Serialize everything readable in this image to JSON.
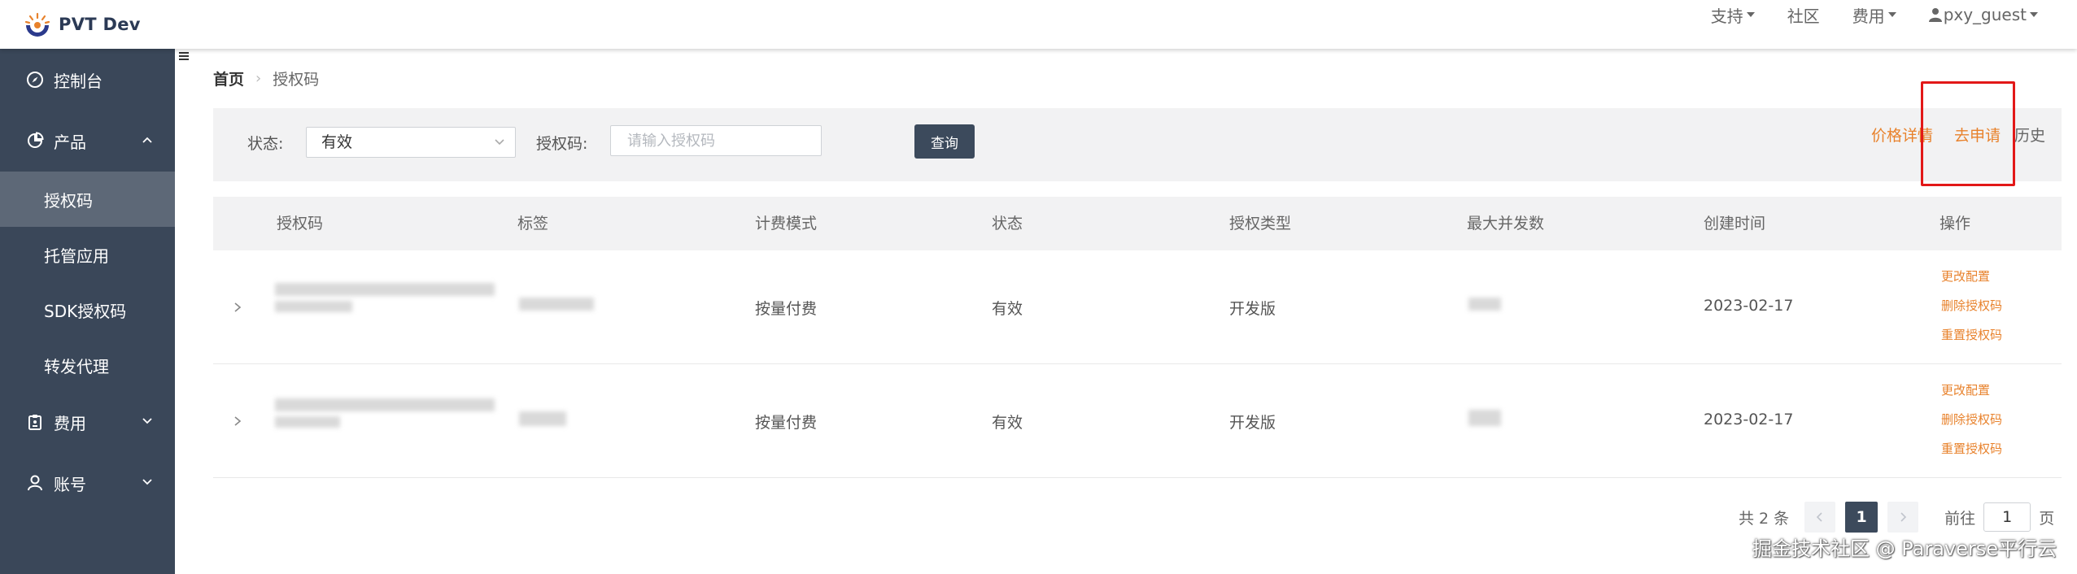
{
  "app": {
    "brand": "PVT Dev"
  },
  "topnav": {
    "support": "支持",
    "community": "社区",
    "fees": "费用",
    "user": "pxy_guest"
  },
  "sidebar": {
    "items": [
      {
        "label": "控制台"
      },
      {
        "label": "产品"
      },
      {
        "label": "授权码"
      },
      {
        "label": "托管应用"
      },
      {
        "label": "SDK授权码"
      },
      {
        "label": "转发代理"
      },
      {
        "label": "费用"
      },
      {
        "label": "账号"
      }
    ]
  },
  "breadcrumb": {
    "home": "首页",
    "current": "授权码"
  },
  "filters": {
    "status_label": "状态:",
    "status_value": "有效",
    "code_label": "授权码:",
    "code_placeholder": "请输入授权码",
    "query_button": "查询"
  },
  "links": {
    "price": "价格详情",
    "apply": "去申请",
    "history": "历史"
  },
  "table": {
    "headers": [
      "授权码",
      "标签",
      "计费模式",
      "状态",
      "授权类型",
      "最大并发数",
      "创建时间",
      "操作"
    ],
    "rows": [
      {
        "billing": "按量付费",
        "status": "有效",
        "type": "开发版",
        "created": "2023-02-17",
        "ops": [
          "更改配置",
          "删除授权码",
          "重置授权码"
        ]
      },
      {
        "billing": "按量付费",
        "status": "有效",
        "type": "开发版",
        "created": "2023-02-17",
        "ops": [
          "更改配置",
          "删除授权码",
          "重置授权码"
        ]
      }
    ]
  },
  "pagination": {
    "total": "共 2 条",
    "current_page": "1",
    "goto_prefix": "前往",
    "goto_value": "1",
    "goto_suffix": "页"
  },
  "watermark": "掘金技术社区 @ Paraverse平行云",
  "colors": {
    "sidebar_bg": "#3a4759",
    "sidebar_active": "#5d6877",
    "accent_orange": "#e8822c",
    "primary_dark": "#3c4a5c",
    "highlight_red": "#e21818"
  }
}
